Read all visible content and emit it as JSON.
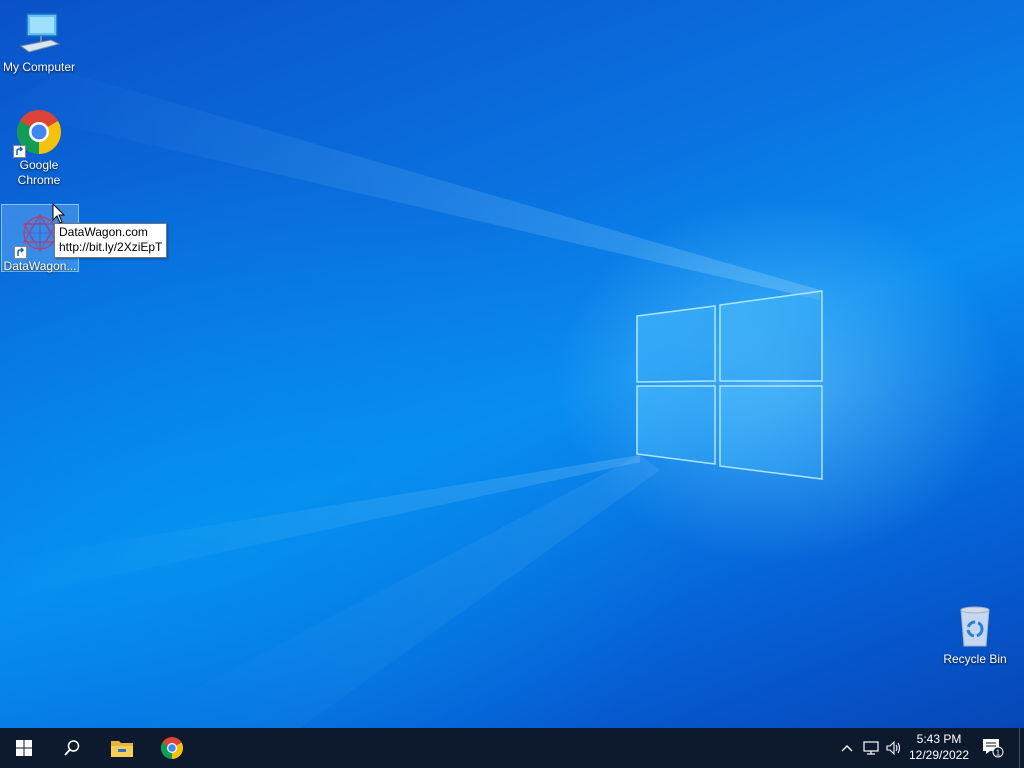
{
  "desktop": {
    "icons": [
      {
        "label": "My Computer",
        "icon": "computer-icon"
      },
      {
        "label": "Google\nChrome",
        "icon": "chrome-icon"
      },
      {
        "label": "DataWagon...",
        "icon": "datawagon-icon",
        "selected": true
      },
      {
        "label": "Recycle Bin",
        "icon": "recycle-bin-icon"
      }
    ],
    "tooltip": {
      "line1": "DataWagon.com",
      "line2": "http://bit.ly/2XziEpT"
    }
  },
  "taskbar": {
    "buttons": [
      "start-icon",
      "search-icon",
      "file-explorer-icon",
      "chrome-icon"
    ],
    "tray": [
      "chevron-up-icon",
      "network-icon",
      "volume-icon"
    ],
    "clock": {
      "time": "5:43 PM",
      "date": "12/29/2022"
    },
    "notification_count": "1"
  },
  "colors": {
    "taskbar": "#0d1a2d",
    "desktop_accent": "#0a73e0"
  }
}
